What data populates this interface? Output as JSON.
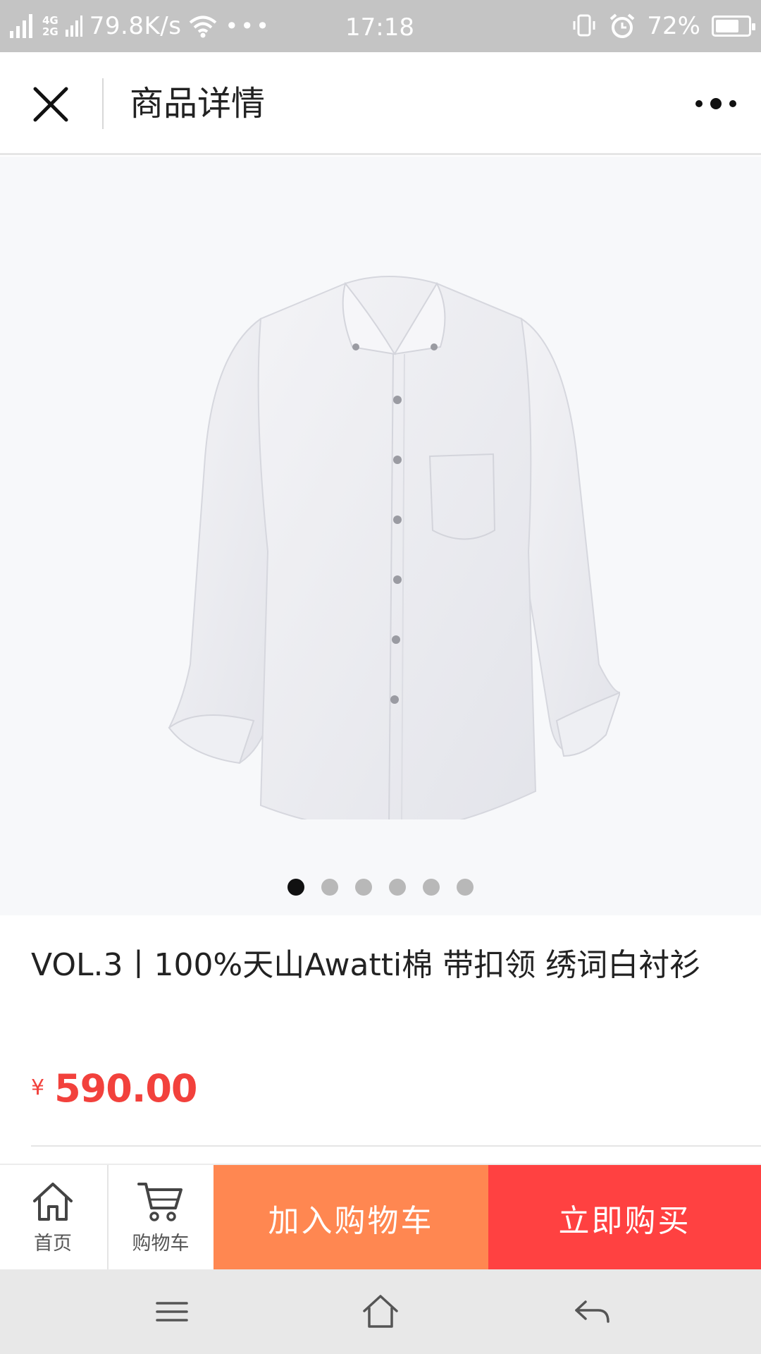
{
  "status_bar": {
    "network_labels": [
      "2G",
      "4G",
      "2G"
    ],
    "speed": "79.8K/s",
    "more": "•••",
    "time": "17:18",
    "battery_percent": "72%",
    "battery_level": 0.72,
    "icons": [
      "signal-icon",
      "wifi-icon",
      "vibrate-icon",
      "alarm-icon",
      "battery-icon"
    ]
  },
  "header": {
    "title": "商品详情",
    "close_icon": "close-icon",
    "more_icon": "more-dots-icon"
  },
  "gallery": {
    "image": "white-shirt",
    "slide_count": 6,
    "active_slide": 1
  },
  "product": {
    "title": "VOL.3丨100%天山Awatti棉 带扣领 绣词白衬衫",
    "currency_symbol": "¥",
    "price": "590.00"
  },
  "action_bar": {
    "home_label": "首页",
    "cart_label": "购物车",
    "add_to_cart_label": "加入购物车",
    "buy_now_label": "立即购买"
  },
  "colors": {
    "status_bar_bg": "#c4c4c4",
    "price": "#f2413c",
    "add_to_cart_bg": "#ff8751",
    "buy_now_bg": "#ff4141",
    "nav_bar_bg": "#e8e8e8"
  },
  "system_nav": {
    "icons": [
      "menu-icon",
      "home-icon",
      "back-icon"
    ]
  }
}
